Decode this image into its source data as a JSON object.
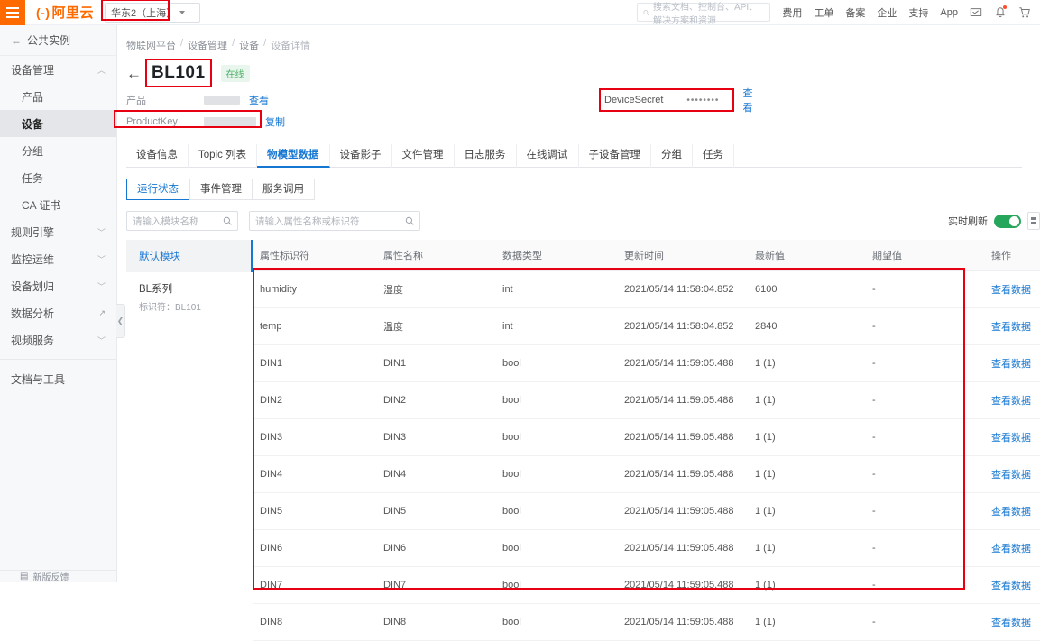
{
  "topbar": {
    "menu_icon": "hamburger-icon",
    "logo": "阿里云",
    "logo_mark": "(-)",
    "region": "华东2（上海）",
    "search_placeholder": "搜索文档、控制台、API、解决方案和资源",
    "nav": [
      "费用",
      "工单",
      "备案",
      "企业",
      "支持",
      "App"
    ],
    "icons": [
      "screen-icon",
      "bell-icon",
      "cart-icon"
    ]
  },
  "sidebar": {
    "back_label": "公共实例",
    "groups": [
      {
        "label": "设备管理",
        "expanded": true
      },
      {
        "label": "规则引擎",
        "expanded": false
      },
      {
        "label": "监控运维",
        "expanded": false
      },
      {
        "label": "设备划归",
        "expanded": false
      },
      {
        "label": "数据分析",
        "external": true
      },
      {
        "label": "视频服务",
        "expanded": false
      }
    ],
    "items": [
      {
        "label": "产品",
        "active": false
      },
      {
        "label": "设备",
        "active": true
      },
      {
        "label": "分组",
        "active": false
      },
      {
        "label": "任务",
        "active": false
      },
      {
        "label": "CA 证书",
        "active": false
      }
    ],
    "docs_label": "文档与工具",
    "bottom_label": "新版反馈"
  },
  "breadcrumb": [
    "物联网平台",
    "设备管理",
    "设备",
    "设备详情"
  ],
  "device": {
    "name": "BL101",
    "status_badge": "在线",
    "product_label": "产品",
    "product_view_link": "查看",
    "product_key_label": "ProductKey",
    "product_key_copy_link": "复制",
    "device_secret_label": "DeviceSecret",
    "device_secret_value": "••••••••",
    "device_secret_view_link": "查看"
  },
  "tabs": [
    {
      "label": "设备信息",
      "active": false
    },
    {
      "label": "Topic 列表",
      "active": false
    },
    {
      "label": "物模型数据",
      "active": true
    },
    {
      "label": "设备影子",
      "active": false
    },
    {
      "label": "文件管理",
      "active": false
    },
    {
      "label": "日志服务",
      "active": false
    },
    {
      "label": "在线调试",
      "active": false
    },
    {
      "label": "子设备管理",
      "active": false
    },
    {
      "label": "分组",
      "active": false
    },
    {
      "label": "任务",
      "active": false
    }
  ],
  "subtabs": [
    {
      "label": "运行状态",
      "active": true
    },
    {
      "label": "事件管理",
      "active": false
    },
    {
      "label": "服务调用",
      "active": false
    }
  ],
  "filters": {
    "module_placeholder": "请输入模块名称",
    "property_placeholder": "请输入属性名称或标识符",
    "refresh_label": "实时刷新",
    "refresh_on": true
  },
  "modules": [
    {
      "label": "默认模块",
      "sub": "",
      "active": true
    },
    {
      "label": "BL系列",
      "sub": "标识符：BL101",
      "active": false
    }
  ],
  "table": {
    "headers": [
      "属性标识符",
      "属性名称",
      "数据类型",
      "更新时间",
      "最新值",
      "期望值",
      "操作"
    ],
    "action_label": "查看数据",
    "rows": [
      {
        "id": "humidity",
        "name": "湿度",
        "type": "int",
        "time": "2021/05/14 11:58:04.852",
        "latest": "6100",
        "expected": "-"
      },
      {
        "id": "temp",
        "name": "温度",
        "type": "int",
        "time": "2021/05/14 11:58:04.852",
        "latest": "2840",
        "expected": "-"
      },
      {
        "id": "DIN1",
        "name": "DIN1",
        "type": "bool",
        "time": "2021/05/14 11:59:05.488",
        "latest": "1 (1)",
        "expected": "-"
      },
      {
        "id": "DIN2",
        "name": "DIN2",
        "type": "bool",
        "time": "2021/05/14 11:59:05.488",
        "latest": "1 (1)",
        "expected": "-"
      },
      {
        "id": "DIN3",
        "name": "DIN3",
        "type": "bool",
        "time": "2021/05/14 11:59:05.488",
        "latest": "1 (1)",
        "expected": "-"
      },
      {
        "id": "DIN4",
        "name": "DIN4",
        "type": "bool",
        "time": "2021/05/14 11:59:05.488",
        "latest": "1 (1)",
        "expected": "-"
      },
      {
        "id": "DIN5",
        "name": "DIN5",
        "type": "bool",
        "time": "2021/05/14 11:59:05.488",
        "latest": "1 (1)",
        "expected": "-"
      },
      {
        "id": "DIN6",
        "name": "DIN6",
        "type": "bool",
        "time": "2021/05/14 11:59:05.488",
        "latest": "1 (1)",
        "expected": "-"
      },
      {
        "id": "DIN7",
        "name": "DIN7",
        "type": "bool",
        "time": "2021/05/14 11:59:05.488",
        "latest": "1 (1)",
        "expected": "-"
      },
      {
        "id": "DIN8",
        "name": "DIN8",
        "type": "bool",
        "time": "2021/05/14 11:59:05.488",
        "latest": "1 (1)",
        "expected": "-"
      }
    ]
  },
  "colors": {
    "brand": "#ff6a00",
    "accent": "#1677d2",
    "annotation": "#e60012",
    "online": "#4cae62",
    "toggle_on": "#26a65b"
  }
}
